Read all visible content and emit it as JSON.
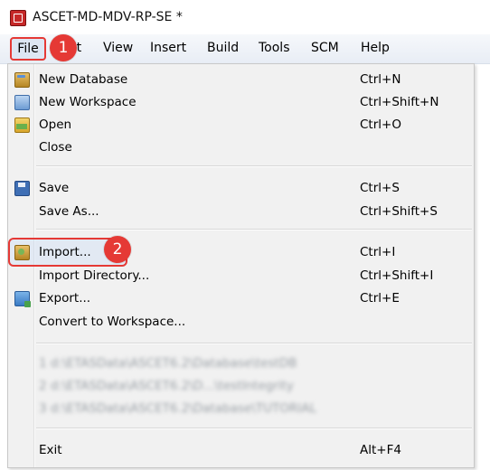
{
  "window": {
    "title": "ASCET-MD-MDV-RP-SE *"
  },
  "menubar": {
    "items": [
      "File",
      "Edit",
      "View",
      "Insert",
      "Build",
      "Tools",
      "SCM",
      "Help"
    ]
  },
  "annotations": {
    "step1": "1",
    "step2": "2"
  },
  "file_menu": {
    "items": [
      {
        "label": "New Database",
        "shortcut": "Ctrl+N",
        "icon": "database-icon"
      },
      {
        "label": "New Workspace",
        "shortcut": "Ctrl+Shift+N",
        "icon": "workspace-icon"
      },
      {
        "label": "Open",
        "shortcut": "Ctrl+O",
        "icon": "open-folder-icon"
      },
      {
        "label": "Close",
        "shortcut": ""
      },
      {
        "label": "Save",
        "shortcut": "Ctrl+S",
        "icon": "save-disk-icon"
      },
      {
        "label": "Save As...",
        "shortcut": "Ctrl+Shift+S"
      },
      {
        "label": "Import...",
        "shortcut": "Ctrl+I",
        "icon": "import-icon"
      },
      {
        "label": "Import Directory...",
        "shortcut": "Ctrl+Shift+I"
      },
      {
        "label": "Export...",
        "shortcut": "Ctrl+E",
        "icon": "export-icon"
      },
      {
        "label": "Convert to Workspace...",
        "shortcut": ""
      },
      {
        "label": "1 d:\\ETASData\\ASCET6.2\\Database\\testDB",
        "shortcut": ""
      },
      {
        "label": "2 d:\\ETASData\\ASCET6.2\\D...\\testIntegrity",
        "shortcut": ""
      },
      {
        "label": "3 d:\\ETASData\\ASCET6.2\\Database\\TUTORIAL",
        "shortcut": ""
      },
      {
        "label": "Exit",
        "shortcut": "Alt+F4"
      }
    ]
  }
}
